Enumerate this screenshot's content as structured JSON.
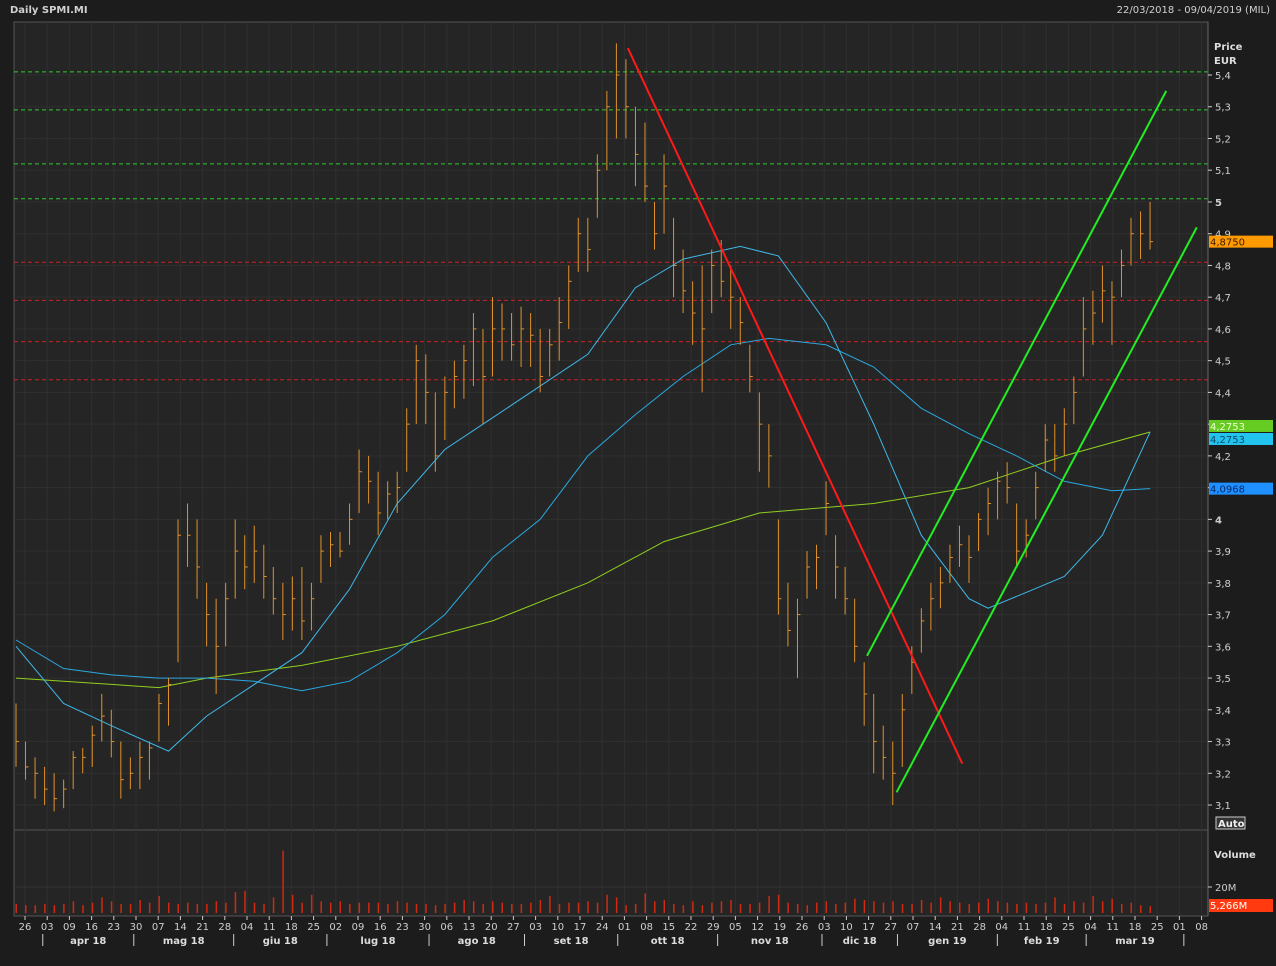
{
  "header": {
    "title": "Daily SPMI.MI",
    "range": "22/03/2018 - 09/04/2019 (MIL)"
  },
  "price_axis": {
    "label_line1": "Price",
    "label_line2": "EUR",
    "auto_button": "Auto"
  },
  "volume_axis": {
    "label": "Volume",
    "tick": "20M",
    "last_volume_tag": "5,266M"
  },
  "tags": [
    {
      "text": "4,8750",
      "value": 4.875,
      "bg": "#ff9a00",
      "fg": "#3a1c00"
    },
    {
      "text": "4,2753",
      "value": 4.2753,
      "bg": "#66cc22",
      "fg": "#eaffd0",
      "offset": -6
    },
    {
      "text": "4,2753",
      "value": 4.2753,
      "bg": "#22c4ee",
      "fg": "#0a4a6a",
      "offset": 7
    },
    {
      "text": "4,0968",
      "value": 4.0968,
      "bg": "#1e90ff",
      "fg": "#0a2a6a"
    }
  ],
  "colors": {
    "bars": "#e0922a",
    "volume": "#d02a10",
    "ma_fast": "#3fb8e8",
    "ma_mid": "#2aa8e0",
    "ma_slow": "#8fd020",
    "trend_down": "#ff1a1a",
    "trend_up": "#22ee22",
    "res_green": "#2ecc2e",
    "sup_red": "#cc2222"
  },
  "chart_data": {
    "type": "ohlc-bar",
    "title": "Daily SPMI.MI",
    "ylabel": "Price EUR",
    "ylim": [
      3.1,
      5.4
    ],
    "yticks": [
      "3,1",
      "3,2",
      "3,3",
      "3,4",
      "3,5",
      "3,6",
      "3,7",
      "3,8",
      "3,9",
      "4",
      "4,1",
      "4,2",
      "4,3",
      "4,4",
      "4,5",
      "4,6",
      "4,7",
      "4,8",
      "4,9",
      "5",
      "5,1",
      "5,2",
      "5,3",
      "5,4"
    ],
    "ytick_values": [
      3.1,
      3.2,
      3.3,
      3.4,
      3.5,
      3.6,
      3.7,
      3.8,
      3.9,
      4.0,
      4.1,
      4.2,
      4.3,
      4.4,
      4.5,
      4.6,
      4.7,
      4.8,
      4.9,
      5.0,
      5.1,
      5.2,
      5.3,
      5.4
    ],
    "xtick_labels": [
      "26",
      "03",
      "09",
      "16",
      "23",
      "30",
      "07",
      "14",
      "21",
      "28",
      "04",
      "11",
      "18",
      "25",
      "02",
      "09",
      "16",
      "23",
      "30",
      "06",
      "13",
      "20",
      "27",
      "03",
      "10",
      "17",
      "24",
      "01",
      "08",
      "15",
      "22",
      "29",
      "05",
      "12",
      "19",
      "26",
      "03",
      "10",
      "17",
      "27",
      "07",
      "14",
      "21",
      "28",
      "04",
      "11",
      "18",
      "25",
      "04",
      "11",
      "18",
      "25",
      "01",
      "08"
    ],
    "months": [
      "apr 18",
      "mag 18",
      "giu 18",
      "lug 18",
      "ago 18",
      "set 18",
      "ott 18",
      "nov 18",
      "dic 18",
      "gen 19",
      "feb 19",
      "mar 19"
    ],
    "bars_hlc": [
      [
        3.42,
        3.22,
        3.3
      ],
      [
        3.3,
        3.18,
        3.22
      ],
      [
        3.25,
        3.12,
        3.2
      ],
      [
        3.22,
        3.1,
        3.15
      ],
      [
        3.2,
        3.08,
        3.12
      ],
      [
        3.18,
        3.09,
        3.15
      ],
      [
        3.27,
        3.15,
        3.25
      ],
      [
        3.28,
        3.2,
        3.25
      ],
      [
        3.35,
        3.22,
        3.32
      ],
      [
        3.45,
        3.3,
        3.38
      ],
      [
        3.4,
        3.25,
        3.3
      ],
      [
        3.3,
        3.12,
        3.18
      ],
      [
        3.25,
        3.15,
        3.2
      ],
      [
        3.3,
        3.15,
        3.25
      ],
      [
        3.3,
        3.18,
        3.28
      ],
      [
        3.45,
        3.3,
        3.42
      ],
      [
        3.5,
        3.35,
        3.48
      ],
      [
        4.0,
        3.55,
        3.95
      ],
      [
        4.05,
        3.85,
        3.95
      ],
      [
        4.0,
        3.75,
        3.85
      ],
      [
        3.8,
        3.6,
        3.7
      ],
      [
        3.75,
        3.45,
        3.6
      ],
      [
        3.8,
        3.6,
        3.75
      ],
      [
        4.0,
        3.75,
        3.9
      ],
      [
        3.95,
        3.78,
        3.85
      ],
      [
        3.98,
        3.8,
        3.9
      ],
      [
        3.92,
        3.75,
        3.82
      ],
      [
        3.85,
        3.7,
        3.75
      ],
      [
        3.8,
        3.62,
        3.7
      ],
      [
        3.82,
        3.65,
        3.75
      ],
      [
        3.85,
        3.62,
        3.68
      ],
      [
        3.8,
        3.65,
        3.75
      ],
      [
        3.95,
        3.8,
        3.9
      ],
      [
        3.96,
        3.85,
        3.92
      ],
      [
        3.96,
        3.88,
        3.9
      ],
      [
        4.05,
        3.92,
        4.0
      ],
      [
        4.22,
        4.02,
        4.15
      ],
      [
        4.2,
        4.05,
        4.12
      ],
      [
        4.15,
        3.95,
        4.02
      ],
      [
        4.12,
        4.0,
        4.08
      ],
      [
        4.15,
        4.02,
        4.1
      ],
      [
        4.35,
        4.15,
        4.3
      ],
      [
        4.55,
        4.3,
        4.5
      ],
      [
        4.52,
        4.3,
        4.4
      ],
      [
        4.4,
        4.15,
        4.2
      ],
      [
        4.45,
        4.25,
        4.4
      ],
      [
        4.5,
        4.35,
        4.45
      ],
      [
        4.55,
        4.38,
        4.5
      ],
      [
        4.65,
        4.42,
        4.6
      ],
      [
        4.6,
        4.3,
        4.45
      ],
      [
        4.7,
        4.45,
        4.6
      ],
      [
        4.68,
        4.5,
        4.6
      ],
      [
        4.65,
        4.5,
        4.55
      ],
      [
        4.67,
        4.48,
        4.6
      ],
      [
        4.65,
        4.48,
        4.58
      ],
      [
        4.6,
        4.4,
        4.45
      ],
      [
        4.6,
        4.45,
        4.55
      ],
      [
        4.7,
        4.5,
        4.62
      ],
      [
        4.8,
        4.6,
        4.75
      ],
      [
        4.95,
        4.78,
        4.9
      ],
      [
        4.95,
        4.78,
        4.85
      ],
      [
        5.15,
        4.95,
        5.1
      ],
      [
        5.35,
        5.1,
        5.3
      ],
      [
        5.5,
        5.2,
        5.4
      ],
      [
        5.45,
        5.2,
        5.3
      ],
      [
        5.3,
        5.05,
        5.15
      ],
      [
        5.25,
        5.0,
        5.05
      ],
      [
        5.0,
        4.85,
        4.9
      ],
      [
        5.15,
        4.9,
        5.05
      ],
      [
        4.95,
        4.7,
        4.8
      ],
      [
        4.85,
        4.65,
        4.72
      ],
      [
        4.75,
        4.55,
        4.65
      ],
      [
        4.8,
        4.4,
        4.6
      ],
      [
        4.85,
        4.65,
        4.8
      ],
      [
        4.88,
        4.7,
        4.75
      ],
      [
        4.8,
        4.6,
        4.7
      ],
      [
        4.7,
        4.55,
        4.62
      ],
      [
        4.55,
        4.4,
        4.45
      ],
      [
        4.4,
        4.15,
        4.3
      ],
      [
        4.3,
        4.1,
        4.2
      ],
      [
        4.0,
        3.7,
        3.75
      ],
      [
        3.8,
        3.6,
        3.65
      ],
      [
        3.75,
        3.5,
        3.7
      ],
      [
        3.9,
        3.75,
        3.85
      ],
      [
        3.92,
        3.78,
        3.88
      ],
      [
        4.12,
        3.95,
        4.05
      ],
      [
        3.95,
        3.75,
        3.85
      ],
      [
        3.85,
        3.7,
        3.75
      ],
      [
        3.75,
        3.55,
        3.6
      ],
      [
        3.55,
        3.35,
        3.45
      ],
      [
        3.45,
        3.2,
        3.3
      ],
      [
        3.35,
        3.18,
        3.25
      ],
      [
        3.3,
        3.1,
        3.2
      ],
      [
        3.45,
        3.22,
        3.4
      ],
      [
        3.6,
        3.45,
        3.55
      ],
      [
        3.72,
        3.58,
        3.68
      ],
      [
        3.8,
        3.65,
        3.75
      ],
      [
        3.85,
        3.72,
        3.8
      ],
      [
        3.92,
        3.8,
        3.88
      ],
      [
        3.98,
        3.85,
        3.92
      ],
      [
        3.95,
        3.8,
        3.88
      ],
      [
        4.02,
        3.9,
        4.0
      ],
      [
        4.1,
        3.95,
        4.05
      ],
      [
        4.15,
        4.0,
        4.12
      ],
      [
        4.18,
        4.05,
        4.1
      ],
      [
        4.05,
        3.85,
        3.9
      ],
      [
        4.0,
        3.88,
        3.95
      ],
      [
        4.15,
        4.0,
        4.1
      ],
      [
        4.3,
        4.15,
        4.25
      ],
      [
        4.3,
        4.15,
        4.2
      ],
      [
        4.35,
        4.2,
        4.3
      ],
      [
        4.45,
        4.3,
        4.4
      ],
      [
        4.7,
        4.45,
        4.6
      ],
      [
        4.72,
        4.55,
        4.65
      ],
      [
        4.8,
        4.62,
        4.72
      ],
      [
        4.75,
        4.55,
        4.7
      ],
      [
        4.85,
        4.7,
        4.8
      ],
      [
        4.95,
        4.8,
        4.9
      ],
      [
        4.97,
        4.82,
        4.9
      ],
      [
        5.0,
        4.85,
        4.875
      ]
    ],
    "volume_millions": [
      7,
      6,
      6,
      7,
      6,
      7,
      9,
      6,
      8,
      12,
      9,
      7,
      7,
      10,
      8,
      13,
      8,
      7,
      8,
      7,
      7,
      9,
      8,
      16,
      17,
      8,
      7,
      12,
      48,
      14,
      8,
      14,
      9,
      8,
      9,
      7,
      8,
      8,
      8,
      7,
      9,
      8,
      7,
      7,
      6,
      7,
      8,
      10,
      9,
      7,
      9,
      8,
      7,
      7,
      8,
      10,
      13,
      7,
      8,
      8,
      9,
      8,
      14,
      12,
      6,
      7,
      15,
      9,
      10,
      7,
      6,
      9,
      6,
      8,
      9,
      10,
      7,
      7,
      8,
      13,
      14,
      8,
      7,
      6,
      8,
      9,
      7,
      8,
      11,
      10,
      9,
      8,
      9,
      7,
      7,
      10,
      8,
      12,
      9,
      8,
      7,
      8,
      11,
      9,
      8,
      7,
      8,
      7,
      8,
      12,
      7,
      9,
      8,
      13,
      9,
      11,
      7,
      8,
      6,
      5.266
    ],
    "ma_fast": [
      [
        0,
        3.6
      ],
      [
        5,
        3.42
      ],
      [
        10,
        3.35
      ],
      [
        16,
        3.27
      ],
      [
        20,
        3.38
      ],
      [
        25,
        3.48
      ],
      [
        30,
        3.58
      ],
      [
        35,
        3.78
      ],
      [
        40,
        4.05
      ],
      [
        45,
        4.22
      ],
      [
        50,
        4.32
      ],
      [
        55,
        4.42
      ],
      [
        60,
        4.52
      ],
      [
        65,
        4.73
      ],
      [
        70,
        4.82
      ],
      [
        76,
        4.86
      ],
      [
        80,
        4.83
      ],
      [
        85,
        4.62
      ],
      [
        90,
        4.3
      ],
      [
        95,
        3.95
      ],
      [
        100,
        3.75
      ],
      [
        102,
        3.72
      ],
      [
        106,
        3.77
      ],
      [
        110,
        3.82
      ],
      [
        114,
        3.95
      ],
      [
        119,
        4.2753
      ]
    ],
    "ma_mid": [
      [
        0,
        3.62
      ],
      [
        5,
        3.53
      ],
      [
        10,
        3.51
      ],
      [
        15,
        3.5
      ],
      [
        20,
        3.5
      ],
      [
        25,
        3.49
      ],
      [
        30,
        3.46
      ],
      [
        35,
        3.49
      ],
      [
        40,
        3.58
      ],
      [
        45,
        3.7
      ],
      [
        50,
        3.88
      ],
      [
        55,
        4.0
      ],
      [
        60,
        4.2
      ],
      [
        65,
        4.33
      ],
      [
        70,
        4.45
      ],
      [
        75,
        4.55
      ],
      [
        79,
        4.57
      ],
      [
        85,
        4.55
      ],
      [
        90,
        4.48
      ],
      [
        95,
        4.35
      ],
      [
        100,
        4.27
      ],
      [
        105,
        4.2
      ],
      [
        110,
        4.12
      ],
      [
        115,
        4.09
      ],
      [
        119,
        4.0968
      ]
    ],
    "ma_slow": [
      [
        0,
        3.5
      ],
      [
        10,
        3.48
      ],
      [
        15,
        3.47
      ],
      [
        20,
        3.5
      ],
      [
        30,
        3.54
      ],
      [
        40,
        3.6
      ],
      [
        50,
        3.68
      ],
      [
        60,
        3.8
      ],
      [
        68,
        3.93
      ],
      [
        78,
        4.02
      ],
      [
        90,
        4.05
      ],
      [
        100,
        4.1
      ],
      [
        110,
        4.2
      ],
      [
        119,
        4.2753
      ]
    ],
    "resistance_levels": [
      5.41,
      5.29,
      5.12,
      5.01
    ],
    "support_levels": [
      4.81,
      4.69,
      4.56,
      4.44
    ],
    "trendlines": {
      "down": [
        [
          64.2,
          5.485
        ],
        [
          99.3,
          3.23
        ]
      ],
      "up_lower": [
        [
          92.4,
          3.14
        ],
        [
          123.9,
          4.92
        ]
      ],
      "up_upper": [
        [
          89.3,
          3.57
        ],
        [
          120.7,
          5.35
        ]
      ]
    }
  }
}
